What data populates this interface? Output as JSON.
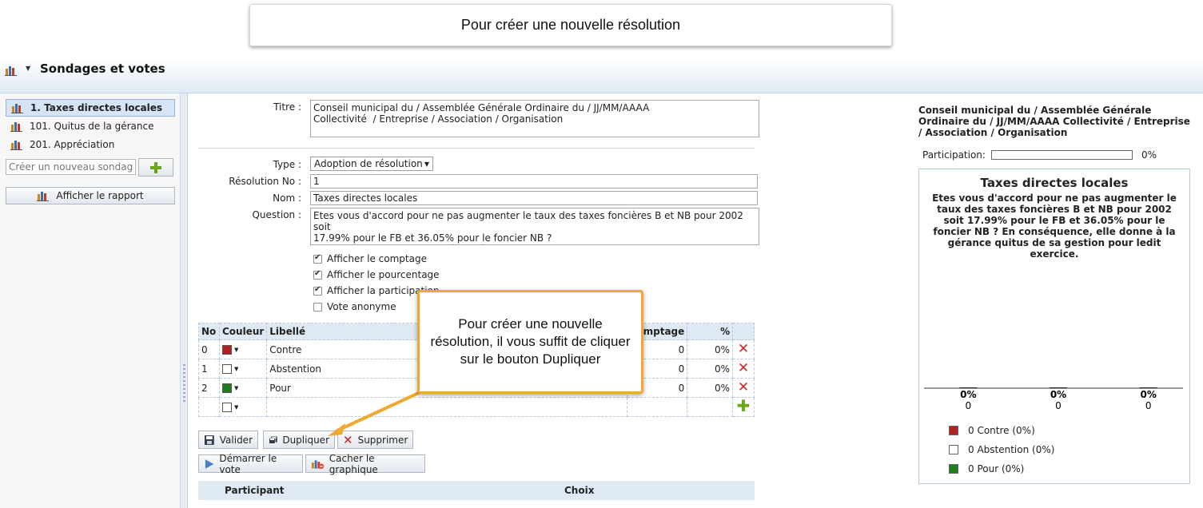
{
  "caption": "Pour créer une nouvelle résolution",
  "app": {
    "title": "Sondages et votes"
  },
  "sidebar": {
    "items": [
      {
        "label": "1. Taxes directes locales",
        "active": true
      },
      {
        "label": "101. Quitus de la gérance",
        "active": false
      },
      {
        "label": "201. Appréciation",
        "active": false
      }
    ],
    "new_survey_placeholder": "Créer un nouveau sondage",
    "report_button": "Afficher le rapport"
  },
  "form": {
    "titre_label": "Titre :",
    "titre_value": "Conseil municipal du / Assemblée Générale Ordinaire du / JJ/MM/AAAA\nCollectivité  / Entreprise / Association / Organisation",
    "type_label": "Type :",
    "type_value": "Adoption de résolution",
    "resolution_no_label": "Résolution No :",
    "resolution_no_value": "1",
    "nom_label": "Nom :",
    "nom_value": "Taxes directes locales",
    "question_label": "Question :",
    "question_value": "Etes vous d'accord pour ne pas augmenter le taux des taxes foncières B et NB pour 2002 soit\n17.99% pour le FB et 36.05% pour le foncier NB ?\nEn conséquence, elle donne à la gérance quitus de sa gestion pour ledit exercice.",
    "options": [
      {
        "label": "Afficher le comptage",
        "checked": true
      },
      {
        "label": "Afficher le pourcentage",
        "checked": true
      },
      {
        "label": "Afficher la participation",
        "checked": true
      },
      {
        "label": "Vote anonyme",
        "checked": false
      }
    ]
  },
  "table": {
    "headers": {
      "no": "No",
      "couleur": "Couleur",
      "libelle": "Libellé",
      "comptage": "Comptage",
      "pct": "%"
    },
    "rows": [
      {
        "no": "0",
        "color": "#b22222",
        "label": "Contre",
        "count": "0",
        "pct": "0%"
      },
      {
        "no": "1",
        "color": "#ffffff",
        "label": "Abstention",
        "count": "0",
        "pct": "0%"
      },
      {
        "no": "2",
        "color": "#1e7d1e",
        "label": "Pour",
        "count": "0",
        "pct": "0%"
      }
    ],
    "new_row_color": "#ffffff"
  },
  "buttons": {
    "valider": "Valider",
    "dupliquer": "Dupliquer",
    "supprimer": "Supprimer",
    "demarrer": "Démarrer le vote",
    "cacher": "Cacher le graphique"
  },
  "participants": {
    "col1": "Participant",
    "col2": "Choix"
  },
  "callout": "Pour créer une nouvelle résolution, il vous suffit de cliquer sur le bouton Dupliquer",
  "preview": {
    "title": "Conseil municipal du / Assemblée Générale Ordinaire du / JJ/MM/AAAA Collectivité / Entreprise / Association / Organisation",
    "participation_label": "Participation:",
    "participation_value": "0%",
    "participation_fraction": 0
  },
  "chart_data": {
    "type": "bar",
    "title": "Taxes directes locales",
    "subtitle": "Etes vous d'accord pour ne pas augmenter le taux des taxes foncières B et NB pour 2002 soit 17.99% pour le FB et 36.05% pour le foncier NB ? En conséquence, elle donne à la gérance quitus de sa gestion pour ledit exercice.",
    "categories": [
      "Contre",
      "Abstention",
      "Pour"
    ],
    "values": [
      0,
      0,
      0
    ],
    "percent_labels": [
      "0%",
      "0%",
      "0%"
    ],
    "count_labels": [
      "0",
      "0",
      "0"
    ],
    "colors": [
      "#b22222",
      "#ffffff",
      "#1e7d1e"
    ],
    "legend": [
      "0 Contre (0%)",
      "0 Abstention (0%)",
      "0 Pour (0%)"
    ],
    "legend_position": "bottom-left"
  }
}
